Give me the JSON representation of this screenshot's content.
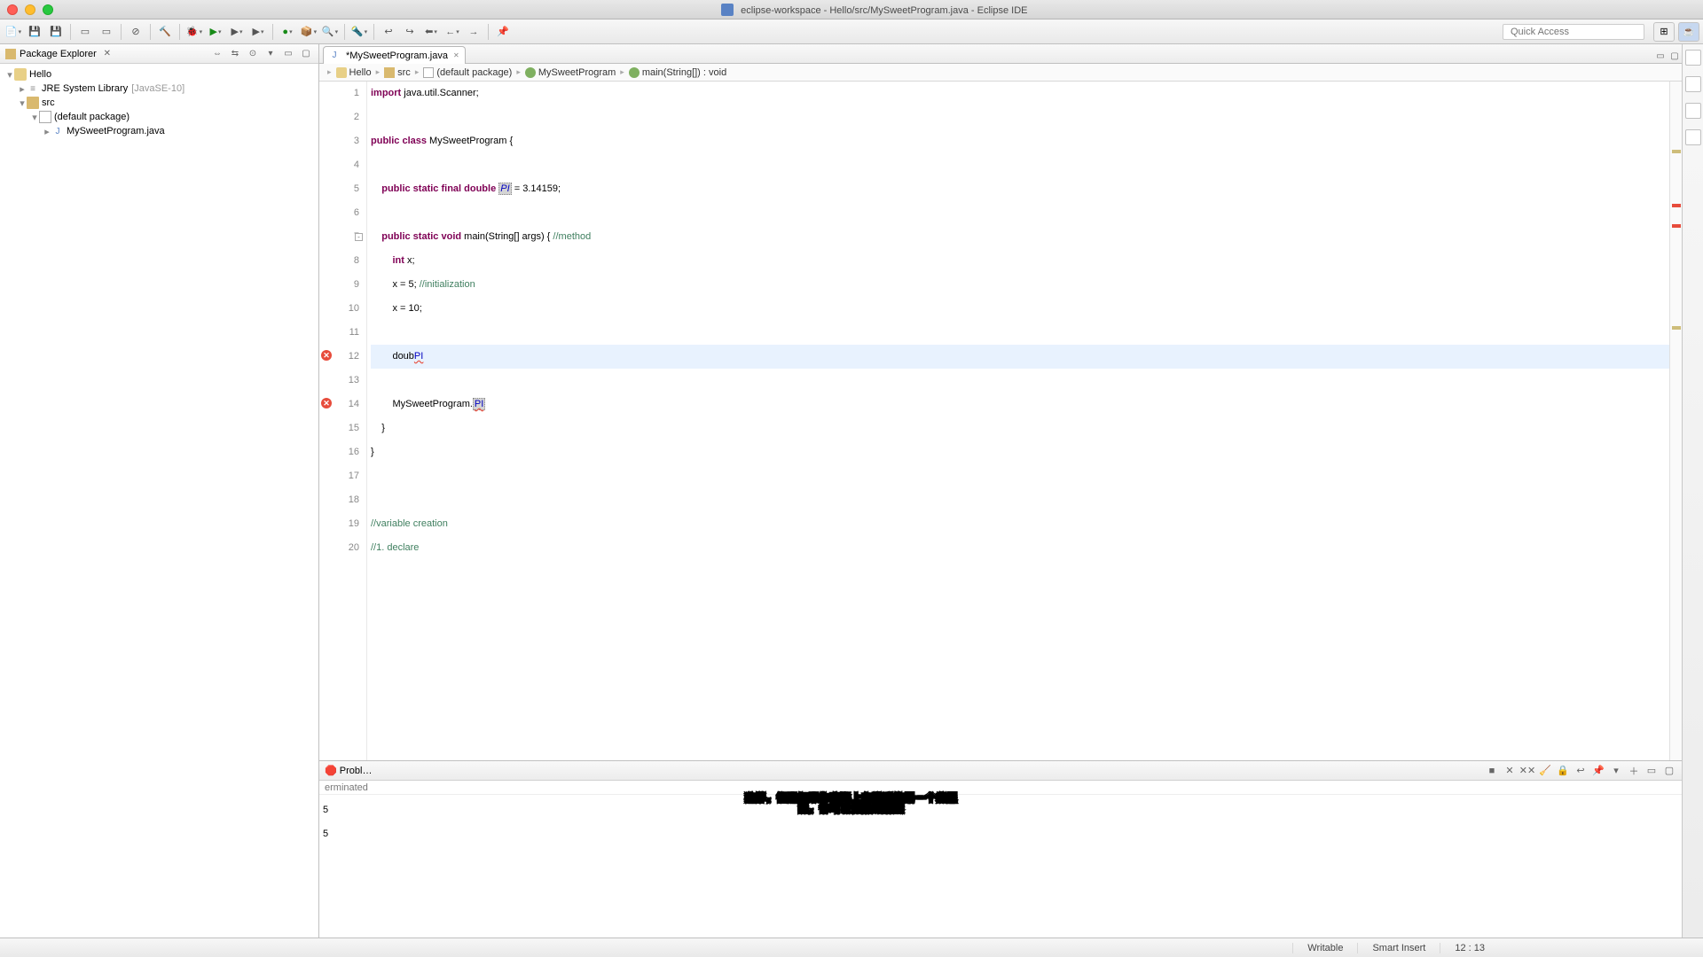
{
  "window": {
    "title": "eclipse-workspace - Hello/src/MySweetProgram.java - Eclipse IDE"
  },
  "toolbar": {
    "quick_access": "Quick Access"
  },
  "package_explorer": {
    "title": "Package Explorer",
    "project": "Hello",
    "jre": "JRE System Library",
    "jre_ver": "[JavaSE-10]",
    "src": "src",
    "pkg": "(default package)",
    "file": "MySweetProgram.java"
  },
  "editor": {
    "tab_name": "*MySweetProgram.java",
    "breadcrumb": {
      "project": "Hello",
      "src": "src",
      "pkg": "(default package)",
      "class": "MySweetProgram",
      "method": "main(String[]) : void"
    },
    "code": {
      "l1a": "import",
      "l1b": " java.util.Scanner;",
      "l3a": "public",
      "l3b": " class",
      "l3c": " MySweetProgram {",
      "l5a": "    public",
      "l5b": " static",
      "l5c": " final",
      "l5d": " double",
      "l5e": " ",
      "l5f": "PI",
      "l5g": " = 3.14159;",
      "l7a": "    public",
      "l7b": " static",
      "l7c": " void",
      "l7d": " main(String[] args) { ",
      "l7e": "//method",
      "l8a": "        int",
      "l8b": " x;",
      "l9a": "        x = 5; ",
      "l9b": "//initialization",
      "l10": "        x = 10;",
      "l12a": "        doub",
      "l12b": "PI",
      "l14a": "        MySweetProgram.",
      "l14b": "PI",
      "l15": "    }",
      "l16": "}",
      "l19": "//variable creation",
      "l20": "//1. declare"
    },
    "line_numbers": [
      "1",
      "2",
      "3",
      "4",
      "5",
      "6",
      "7",
      "8",
      "9",
      "10",
      "11",
      "12",
      "13",
      "14",
      "15",
      "16",
      "17",
      "18",
      "19",
      "20"
    ]
  },
  "console": {
    "tab": "Probl…",
    "terminated": "erminated",
    "out1": "5",
    "out2": "5"
  },
  "statusbar": {
    "writable": "Writable",
    "insert": "Smart Insert",
    "pos": "12 : 13"
  },
  "subtitle": {
    "line1": "这样，但是如果你实际上在稍后的另一个类里",
    "line2": "面，你可以说我的甜蜜"
  }
}
